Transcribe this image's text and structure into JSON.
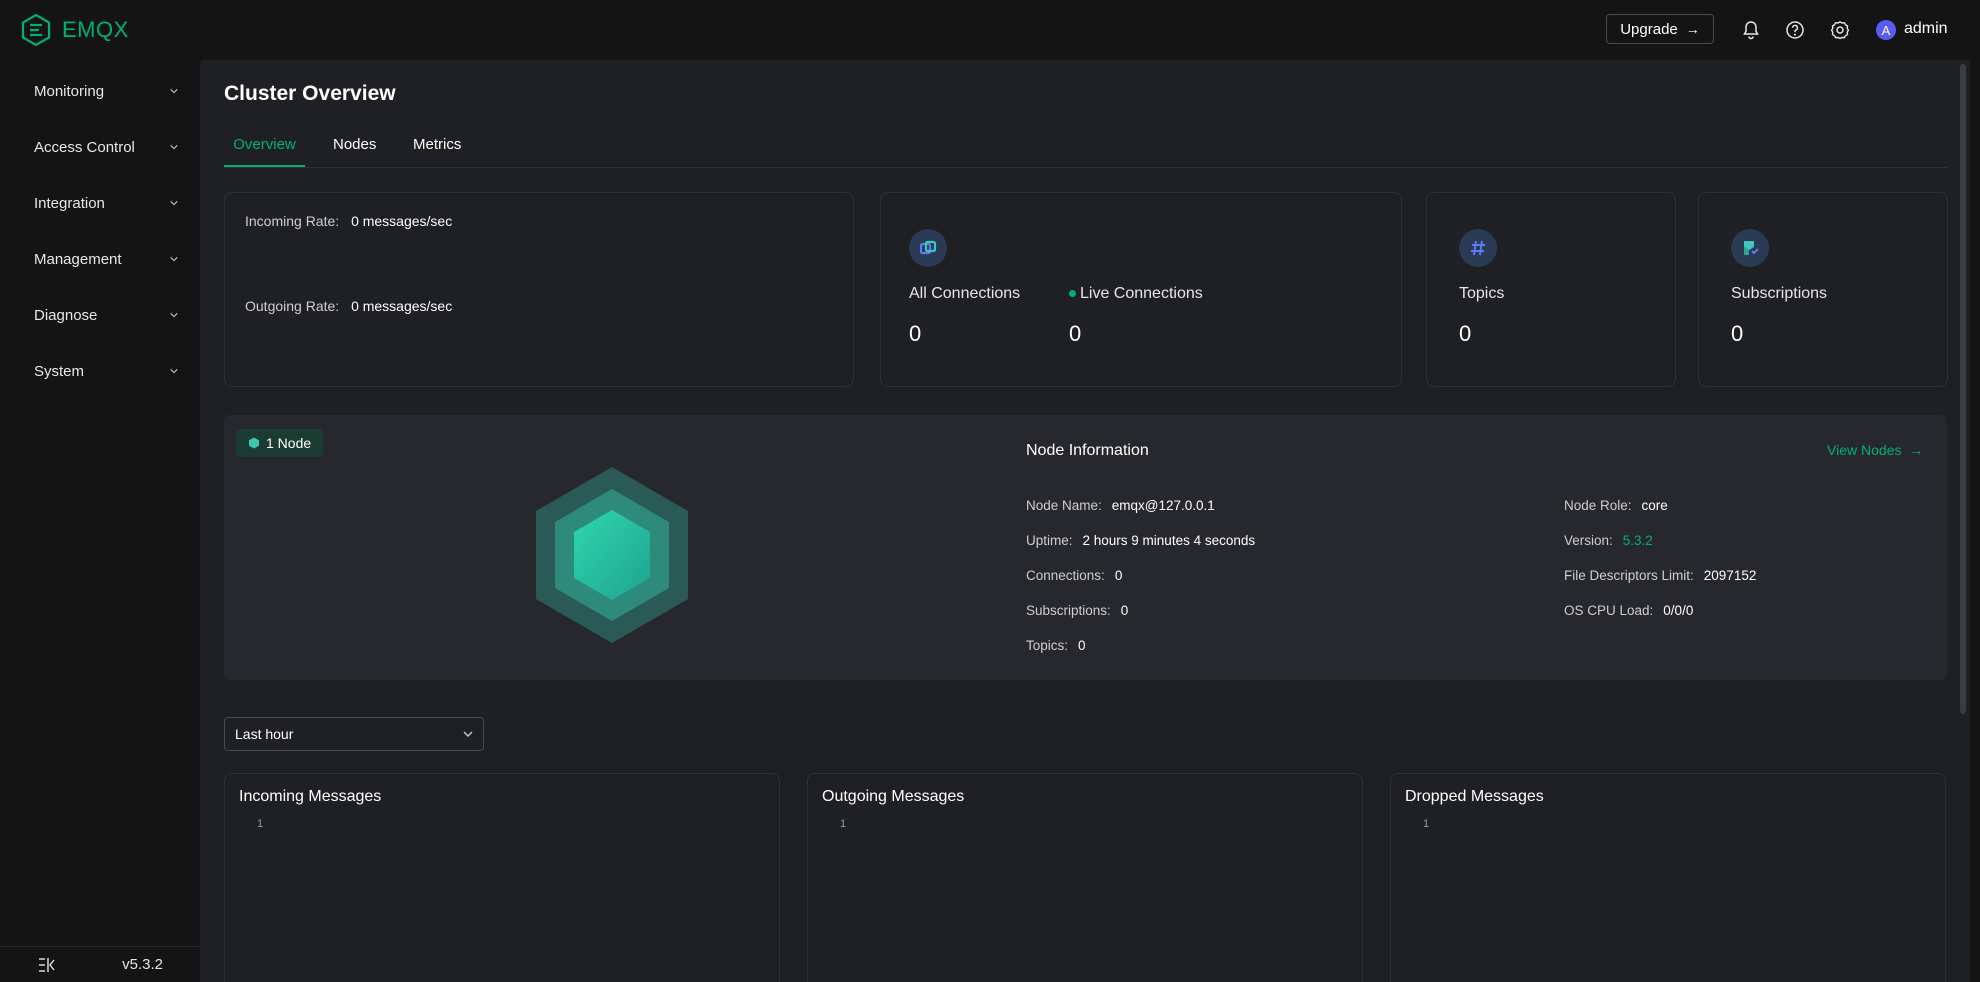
{
  "app": {
    "brand": "EMQX",
    "version_footer": "v5.3.2",
    "accent_color": "#00b173"
  },
  "header": {
    "upgrade_label": "Upgrade",
    "user_initial": "A",
    "user_name": "admin",
    "icons": [
      "bell-icon",
      "help-icon",
      "gear-icon"
    ]
  },
  "sidebar": {
    "items": [
      {
        "label": "Monitoring"
      },
      {
        "label": "Access Control"
      },
      {
        "label": "Integration"
      },
      {
        "label": "Management"
      },
      {
        "label": "Diagnose"
      },
      {
        "label": "System"
      }
    ]
  },
  "page": {
    "title": "Cluster Overview",
    "tabs": [
      {
        "label": "Overview",
        "active": true
      },
      {
        "label": "Nodes",
        "active": false
      },
      {
        "label": "Metrics",
        "active": false
      }
    ]
  },
  "rates": {
    "incoming_label": "Incoming Rate:",
    "incoming_value": "0 messages/sec",
    "outgoing_label": "Outgoing Rate:",
    "outgoing_value": "0 messages/sec"
  },
  "stats": {
    "all_connections_label": "All Connections",
    "all_connections_value": "0",
    "live_connections_label": "Live Connections",
    "live_connections_value": "0",
    "topics_label": "Topics",
    "topics_value": "0",
    "subscriptions_label": "Subscriptions",
    "subscriptions_value": "0"
  },
  "node": {
    "badge": "1 Node",
    "info_title": "Node Information",
    "view_nodes": "View Nodes",
    "left": [
      {
        "label": "Node Name:",
        "value": "emqx@127.0.0.1"
      },
      {
        "label": "Uptime:",
        "value": "2 hours 9 minutes 4 seconds"
      },
      {
        "label": "Connections:",
        "value": "0"
      },
      {
        "label": "Subscriptions:",
        "value": "0"
      },
      {
        "label": "Topics:",
        "value": "0"
      }
    ],
    "right": [
      {
        "label": "Node Role:",
        "value": "core"
      },
      {
        "label": "Version:",
        "value": "5.3.2"
      },
      {
        "label": "File Descriptors Limit:",
        "value": "2097152"
      },
      {
        "label": "OS CPU Load:",
        "value": "0/0/0"
      }
    ]
  },
  "time_range": {
    "selected": "Last hour"
  },
  "charts": [
    {
      "title": "Incoming Messages",
      "tick": "1"
    },
    {
      "title": "Outgoing Messages",
      "tick": "1"
    },
    {
      "title": "Dropped Messages",
      "tick": "1"
    }
  ]
}
